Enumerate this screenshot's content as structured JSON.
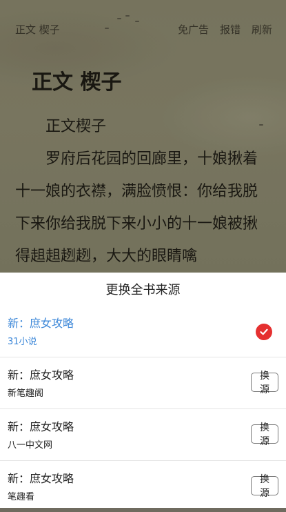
{
  "reader": {
    "chapter_short": "正文 楔子",
    "actions": [
      "免广告",
      "报错",
      "刷新"
    ],
    "chapter_title": "正文 楔子",
    "paragraphs": [
      "正文楔子",
      "罗府后花园的回廊里，十娘揪着十一娘的衣襟，满脸愤恨：你给我脱下来你给我脱下来小小的十一娘被揪得趄趄趔趔，大大的眼睛噙"
    ]
  },
  "sheet": {
    "title": "更换全书来源",
    "switch_label": "换源",
    "sources": [
      {
        "title": "新：庶女攻略",
        "site": "31小说",
        "current": true
      },
      {
        "title": "新：庶女攻略",
        "site": "新笔趣阁",
        "current": false
      },
      {
        "title": "新：庶女攻略",
        "site": "八一中文网",
        "current": false
      },
      {
        "title": "新：庶女攻略",
        "site": "笔趣看",
        "current": false
      }
    ]
  },
  "colors": {
    "accent_blue": "#3a86d8",
    "check_red": "#e53030"
  }
}
